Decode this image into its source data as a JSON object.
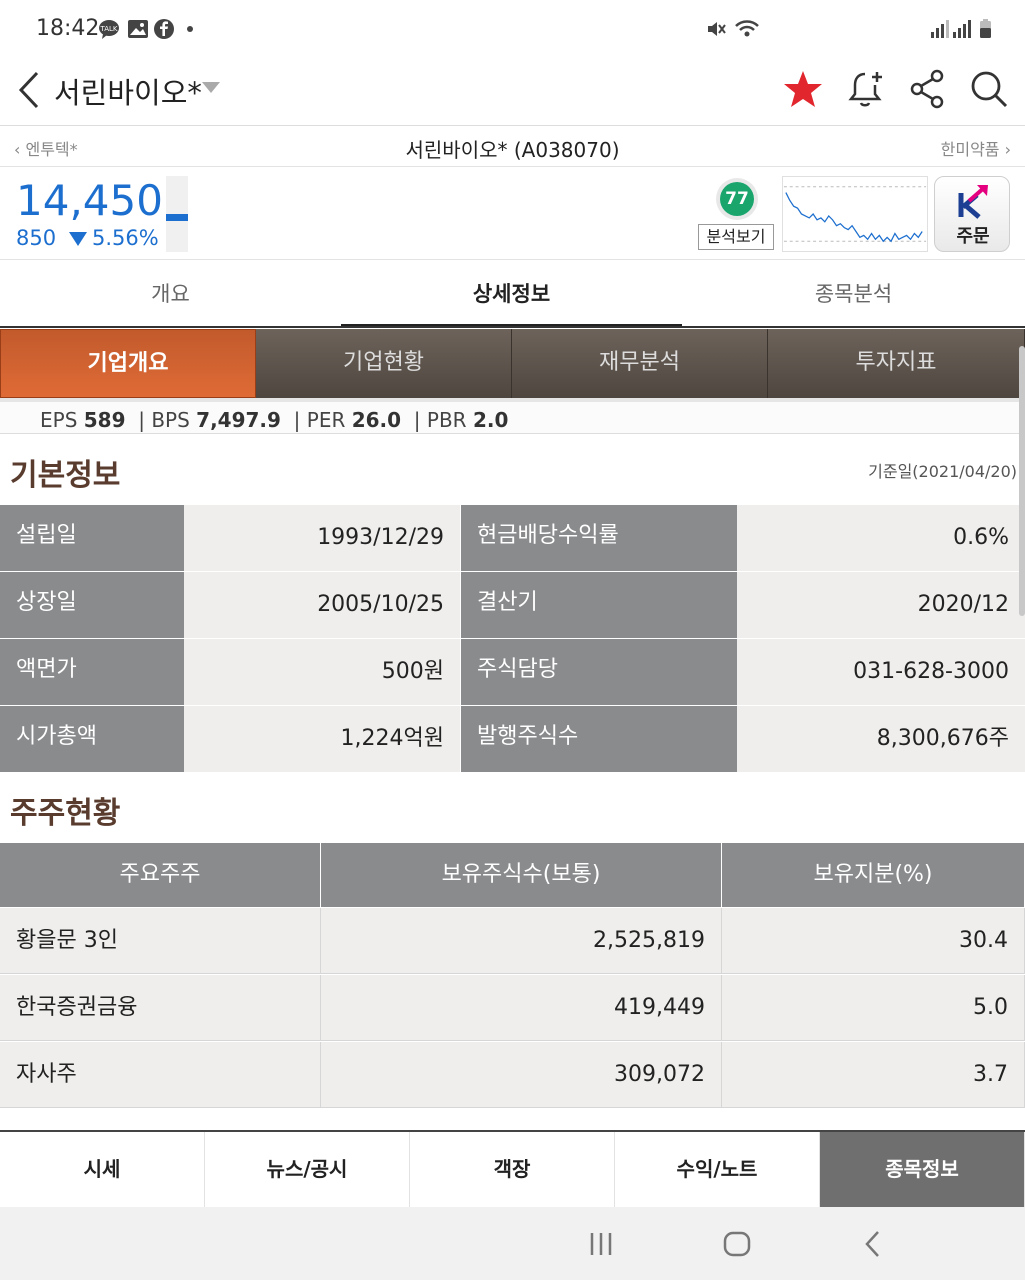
{
  "status_bar": {
    "time": "18:42",
    "icons_left": [
      "kakaotalk-icon",
      "gallery-icon",
      "facebook-icon",
      "dot-icon"
    ],
    "icons_right": [
      "mute-icon",
      "wifi-icon",
      "signal-icon",
      "signal-icon",
      "battery-icon"
    ]
  },
  "header": {
    "title": "서린바이오*",
    "icons": [
      "back-icon",
      "star-icon",
      "alarm-add-icon",
      "share-icon",
      "search-icon"
    ],
    "star_color": "#e1262d"
  },
  "subheader": {
    "prev_stock": "엔투텍*",
    "current": "서린바이오* (A038070)",
    "next_stock": "한미약품"
  },
  "quote": {
    "price": "14,450",
    "change": "850",
    "change_pct": "5.56%",
    "direction": "down",
    "direction_color": "#1d6fcf",
    "score": "77",
    "analysis_button": "분석보기",
    "order_button": "주문"
  },
  "tabs": [
    {
      "label": "개요",
      "active": false
    },
    {
      "label": "상세정보",
      "active": true
    },
    {
      "label": "종목분석",
      "active": false
    }
  ],
  "segments": [
    {
      "label": "기업개요",
      "active": true
    },
    {
      "label": "기업현황",
      "active": false
    },
    {
      "label": "재무분석",
      "active": false
    },
    {
      "label": "투자지표",
      "active": false
    }
  ],
  "indicators": {
    "eps_label": "EPS",
    "eps": "589",
    "bps_label": "BPS",
    "bps": "7,497.9",
    "per_label": "PER",
    "per": "26.0",
    "pbr_label": "PBR",
    "pbr": "2.0"
  },
  "basic_info": {
    "title": "기본정보",
    "base_date": "기준일(2021/04/20)",
    "rows": [
      {
        "l1": "설립일",
        "v1": "1993/12/29",
        "l2": "현금배당수익률",
        "v2": "0.6%"
      },
      {
        "l1": "상장일",
        "v1": "2005/10/25",
        "l2": "결산기",
        "v2": "2020/12"
      },
      {
        "l1": "액면가",
        "v1": "500원",
        "l2": "주식담당",
        "v2": "031-628-3000"
      },
      {
        "l1": "시가총액",
        "v1": "1,224억원",
        "l2": "발행주식수",
        "v2": "8,300,676주"
      }
    ]
  },
  "shareholders": {
    "title": "주주현황",
    "headers": [
      "주요주주",
      "보유주식수(보통)",
      "보유지분(%)"
    ],
    "rows": [
      {
        "name": "황을문 3인",
        "shares": "2,525,819",
        "pct": "30.4"
      },
      {
        "name": "한국증권금융",
        "shares": "419,449",
        "pct": "5.0"
      },
      {
        "name": "자사주",
        "shares": "309,072",
        "pct": "3.7"
      }
    ]
  },
  "bottom_nav": [
    {
      "label": "시세",
      "active": false
    },
    {
      "label": "뉴스/공시",
      "active": false
    },
    {
      "label": "객장",
      "active": false
    },
    {
      "label": "수익/노트",
      "active": false
    },
    {
      "label": "종목정보",
      "active": true
    }
  ],
  "system_nav": [
    "recents-icon",
    "home-icon",
    "back-nav-icon"
  ]
}
